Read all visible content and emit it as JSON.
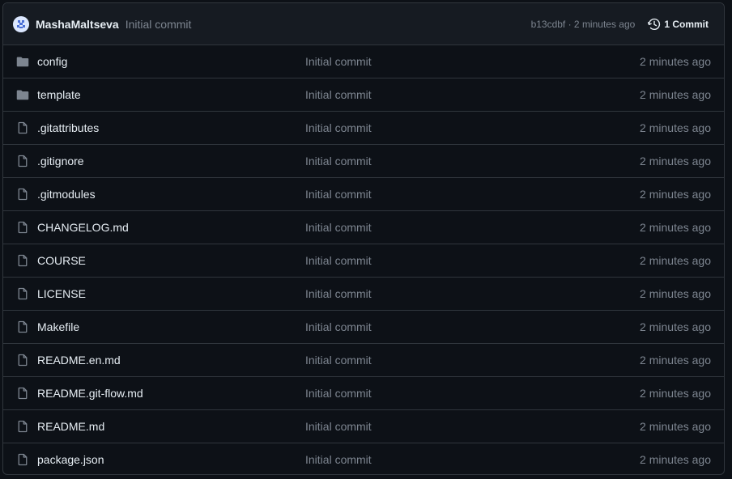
{
  "latest_commit": {
    "author": "MashaMaltseva",
    "message": "Initial commit",
    "sha_time": "b13cdbf · 2 minutes ago",
    "commits_label": "1 Commit"
  },
  "files": [
    {
      "name": "config",
      "type": "folder",
      "message": "Initial commit",
      "age": "2 minutes ago"
    },
    {
      "name": "template",
      "type": "folder",
      "message": "Initial commit",
      "age": "2 minutes ago"
    },
    {
      "name": ".gitattributes",
      "type": "file",
      "message": "Initial commit",
      "age": "2 minutes ago"
    },
    {
      "name": ".gitignore",
      "type": "file",
      "message": "Initial commit",
      "age": "2 minutes ago"
    },
    {
      "name": ".gitmodules",
      "type": "file",
      "message": "Initial commit",
      "age": "2 minutes ago"
    },
    {
      "name": "CHANGELOG.md",
      "type": "file",
      "message": "Initial commit",
      "age": "2 minutes ago"
    },
    {
      "name": "COURSE",
      "type": "file",
      "message": "Initial commit",
      "age": "2 minutes ago"
    },
    {
      "name": "LICENSE",
      "type": "file",
      "message": "Initial commit",
      "age": "2 minutes ago"
    },
    {
      "name": "Makefile",
      "type": "file",
      "message": "Initial commit",
      "age": "2 minutes ago"
    },
    {
      "name": "README.en.md",
      "type": "file",
      "message": "Initial commit",
      "age": "2 minutes ago"
    },
    {
      "name": "README.git-flow.md",
      "type": "file",
      "message": "Initial commit",
      "age": "2 minutes ago"
    },
    {
      "name": "README.md",
      "type": "file",
      "message": "Initial commit",
      "age": "2 minutes ago"
    },
    {
      "name": "package.json",
      "type": "file",
      "message": "Initial commit",
      "age": "2 minutes ago"
    }
  ],
  "colors": {
    "background": "#0d1117",
    "header_background": "#161b22",
    "border": "#30363d",
    "text": "#e6edf3",
    "muted": "#7d8590",
    "icon": "#7d8590"
  }
}
